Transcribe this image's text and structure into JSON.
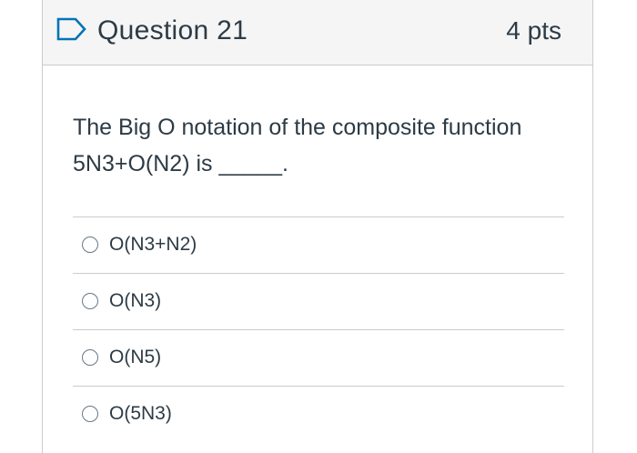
{
  "question": {
    "title": "Question 21",
    "points": "4 pts",
    "flag_icon": "flag-outline-icon",
    "text_line1": "The Big O notation of the composite function",
    "text_line2": "5N3+O(N2) is _____.",
    "answers": [
      {
        "label": "O(N3+N2)"
      },
      {
        "label": "O(N3)"
      },
      {
        "label": "O(N5)"
      },
      {
        "label": "O(5N3)"
      }
    ]
  },
  "colors": {
    "header_bg": "#f5f5f5",
    "border": "#c7cdd1",
    "text": "#2d3b45",
    "flag": "#0374b5"
  }
}
